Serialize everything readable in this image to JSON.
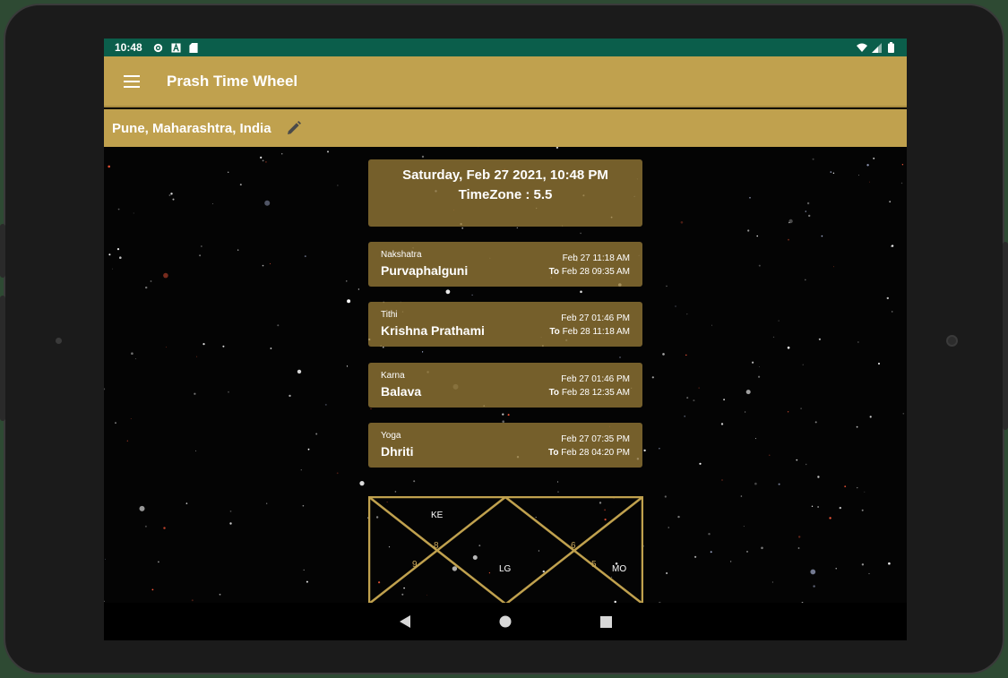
{
  "status_bar": {
    "time": "10:48",
    "icons_left": [
      "settings-icon",
      "a-icon",
      "sd-card-icon"
    ],
    "icons_right": [
      "wifi-icon",
      "signal-icon",
      "battery-icon"
    ]
  },
  "app_bar": {
    "title": "Prash Time Wheel",
    "menu_icon": "menu-icon"
  },
  "location": {
    "text": "Pune, Maharashtra, India",
    "edit_icon": "edit-pencil-icon"
  },
  "date_card": {
    "datetime": "Saturday, Feb 27 2021, 10:48 PM",
    "timezone": "TimeZone : 5.5"
  },
  "cards": [
    {
      "kind": "Nakshatra",
      "name": "Purvaphalguni",
      "from": "Feb 27 11:18 AM",
      "to_label": "To",
      "to": "Feb 28 09:35 AM"
    },
    {
      "kind": "Tithi",
      "name": "Krishna Prathami",
      "from": "Feb 27 01:46 PM",
      "to_label": "To",
      "to": "Feb 28 11:18 AM"
    },
    {
      "kind": "Karna",
      "name": "Balava",
      "from": "Feb 27 01:46 PM",
      "to_label": "To",
      "to": "Feb 28 12:35 AM"
    },
    {
      "kind": "Yoga",
      "name": "Dhriti",
      "from": "Feb 27 07:35 PM",
      "to_label": "To",
      "to": "Feb 28 04:20 PM"
    }
  ],
  "chart": {
    "line_color": "#c0a14e",
    "labels": {
      "ke": "KE",
      "lg": "LG",
      "mo": "MO",
      "h8": "8",
      "h9": "9",
      "h6": "6",
      "h5": "5"
    }
  },
  "nav": {
    "back_icon": "back-triangle-icon",
    "home_icon": "home-circle-icon",
    "recents_icon": "recents-square-icon"
  },
  "colors": {
    "status_bar": "#0b5e4b",
    "app_bar": "#c0a14e",
    "card": "#967a37"
  }
}
